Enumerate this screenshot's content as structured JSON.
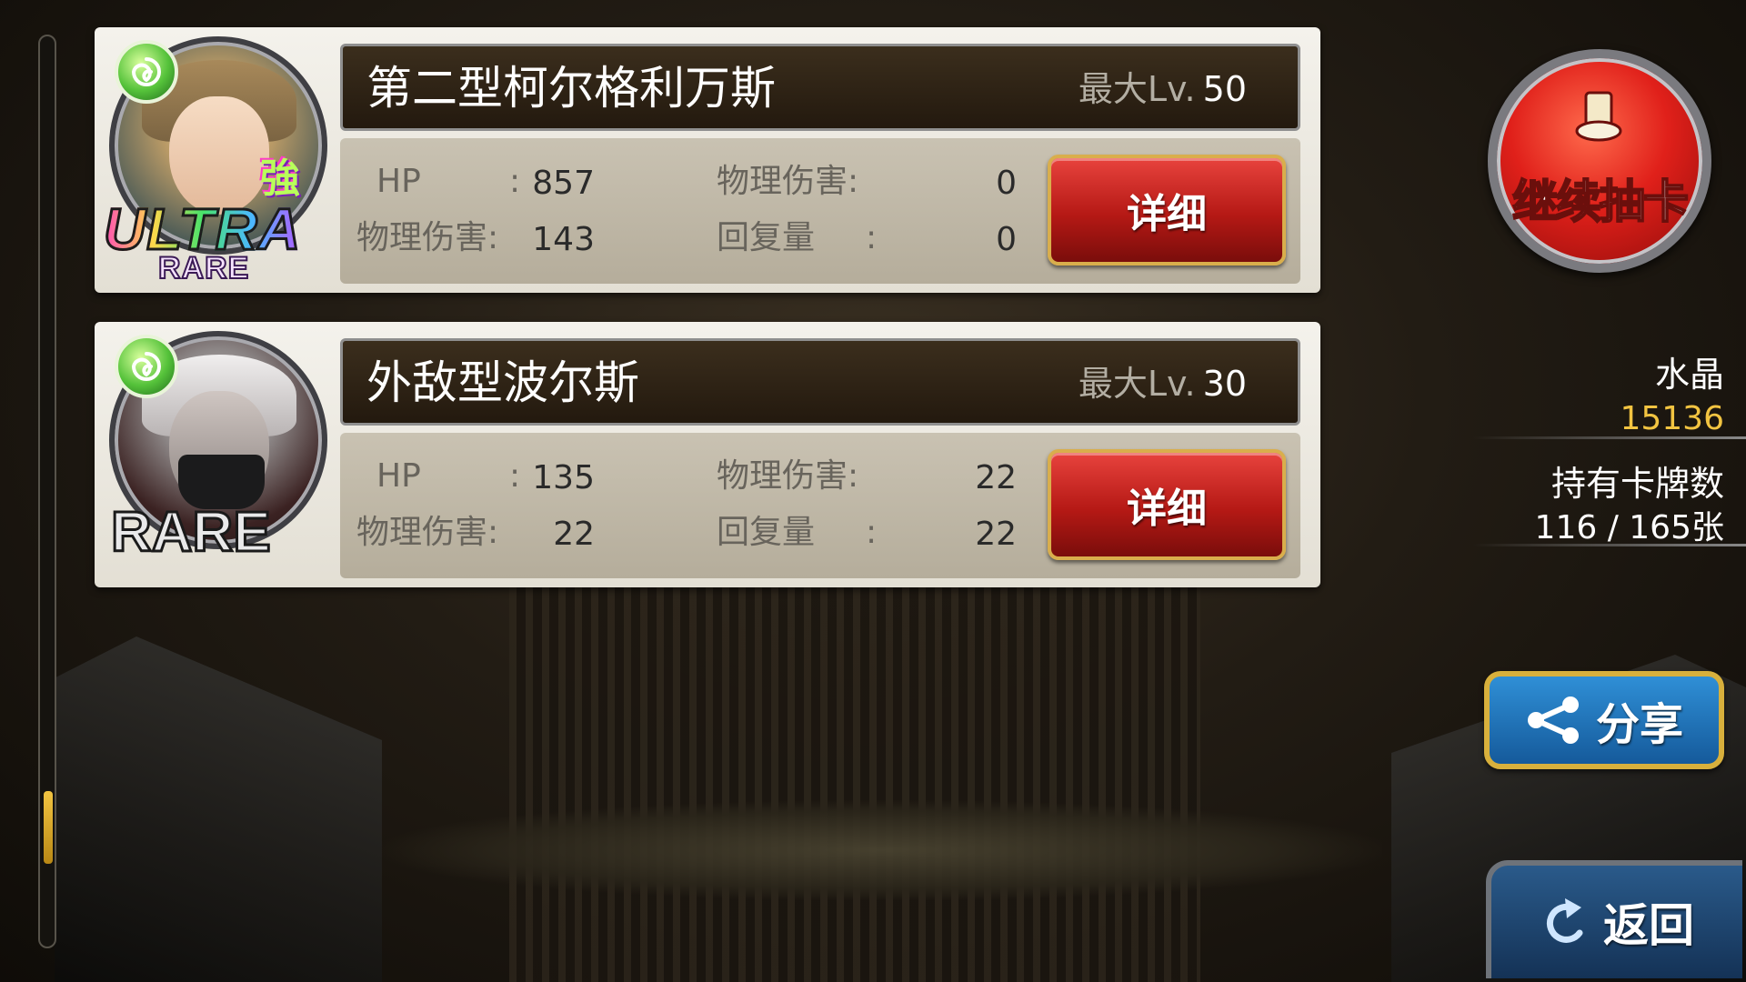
{
  "cards": [
    {
      "name": "第二型柯尔格利万斯",
      "max_lv_label": "最大Lv.",
      "max_lv": "50",
      "rarity_main": "ULTRA",
      "rarity_sub": "RARE",
      "strong_mark": "強",
      "stats": {
        "hp_label": "HP",
        "hp_colon": ":",
        "hp": "857",
        "phys_atk_label": "物理伤害:",
        "phys_atk": "143",
        "phys_dmg_label": "物理伤害:",
        "phys_dmg": "0",
        "recovery_label": "回复量",
        "recovery_colon": ":",
        "recovery": "0"
      },
      "detail_label": "详细"
    },
    {
      "name": "外敌型波尔斯",
      "max_lv_label": "最大Lv.",
      "max_lv": "30",
      "rarity_main": "RARE",
      "stats": {
        "hp_label": "HP",
        "hp_colon": ":",
        "hp": "135",
        "phys_atk_label": "物理伤害:",
        "phys_atk": "22",
        "phys_dmg_label": "物理伤害:",
        "phys_dmg": "22",
        "recovery_label": "回复量",
        "recovery_colon": ":",
        "recovery": "22"
      },
      "detail_label": "详细"
    }
  ],
  "side": {
    "draw_button_label": "继续抽卡",
    "crystal_label": "水晶",
    "crystal_value": "15136",
    "cards_owned_label": "持有卡牌数",
    "cards_owned_value": "116 / 165张",
    "share_label": "分享",
    "back_label": "返回"
  },
  "colors": {
    "crystal_value": "#f2c441",
    "detail_button": "#c4211c",
    "share_button": "#1f76bd",
    "back_button": "#1d416a"
  },
  "icons": {
    "element": "green-swirl-icon",
    "draw": "card-stack-icon",
    "share": "share-icon",
    "back": "return-arrow-icon"
  }
}
